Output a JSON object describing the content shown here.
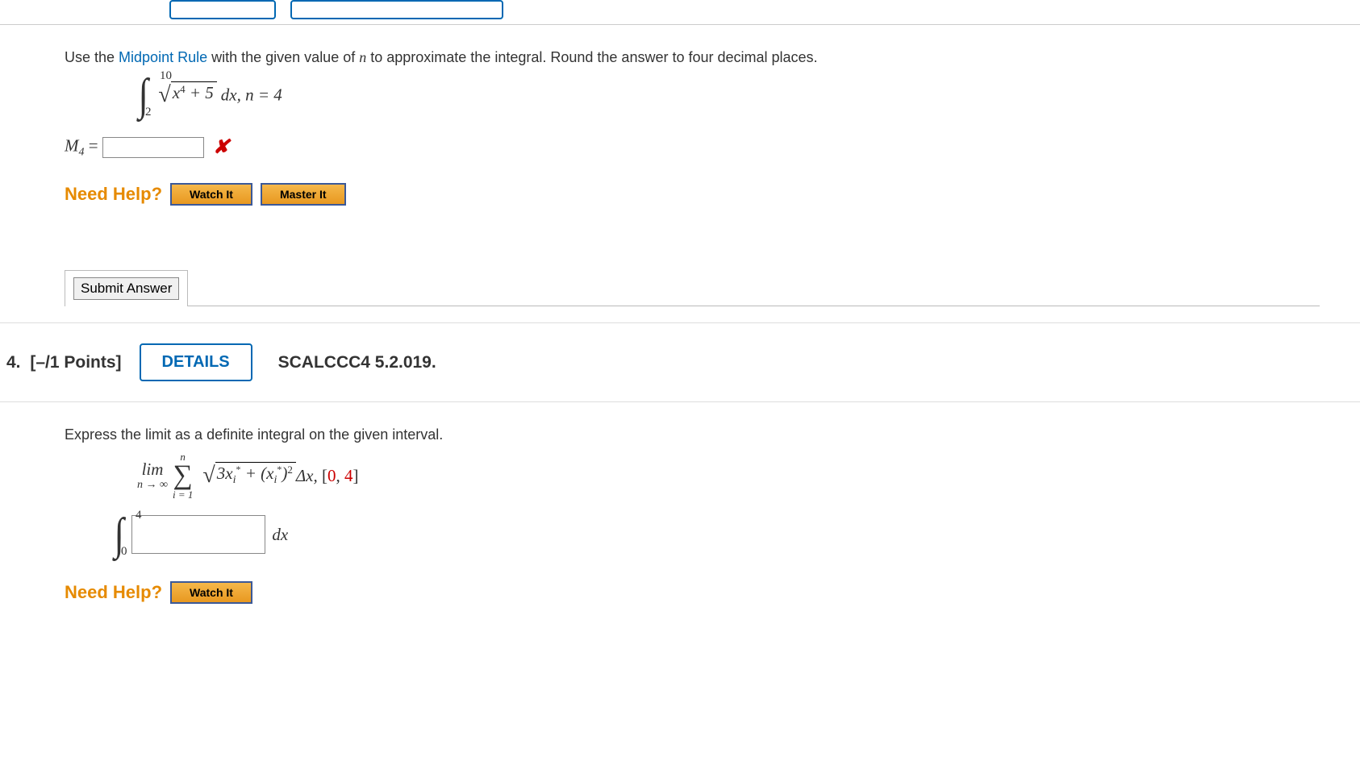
{
  "q3": {
    "prompt_pre": "Use the ",
    "prompt_link": "Midpoint Rule",
    "prompt_post": " with the given value of ",
    "prompt_var": "n",
    "prompt_end": " to approximate the integral. Round the answer to four decimal places.",
    "int_upper": "10",
    "int_lower": "2",
    "radicand_x": "x",
    "radicand_pow": "4",
    "radicand_plus": " + 5",
    "after": " dx, n = 4",
    "answer_label_M": "M",
    "answer_label_sub": "4",
    "answer_label_eq": " = ",
    "need_help": "Need Help?",
    "watch": "Watch It",
    "master": "Master It",
    "submit": "Submit Answer"
  },
  "q4": {
    "number": "4.",
    "points": "[–/1 Points]",
    "details": "DETAILS",
    "ref": "SCALCCC4 5.2.019.",
    "prompt": "Express the limit as a definite integral on the given interval.",
    "lim": "lim",
    "lim_bot": "n → ∞",
    "sigma_top": "n",
    "sigma_bot": "i = 1",
    "three": "3",
    "x": "x",
    "isub": "i",
    "plus": " + (",
    "close": ")",
    "pow2": "2",
    "deltax": " Δx, ",
    "interval_open": "[",
    "interval_a": "0",
    "interval_comma": ", ",
    "interval_b": "4",
    "interval_close": "]",
    "int_upper": "4",
    "int_lower": "0",
    "dx": "dx",
    "need_help": "Need Help?",
    "watch": "Watch It"
  }
}
